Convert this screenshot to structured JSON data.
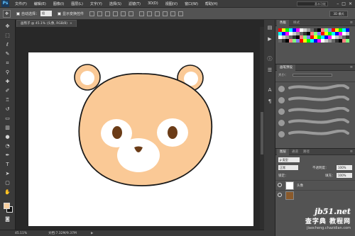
{
  "app": {
    "logo": "Ps"
  },
  "menubar": {
    "items": [
      "文件(F)",
      "编辑(E)",
      "图像(I)",
      "图层(L)",
      "文字(Y)",
      "选择(S)",
      "滤镜(T)",
      "3D(D)",
      "视图(V)",
      "窗口(W)",
      "帮助(H)"
    ],
    "workspace": "基本功能",
    "window_controls": [
      "–",
      "□",
      "✕"
    ]
  },
  "options": {
    "tool_icon": "move-tool-icon",
    "auto_select_label": "自动选择：",
    "auto_select_value": "组",
    "show_transform_label": "显示变换控件",
    "right_button": "3D 模式"
  },
  "document": {
    "tab_title": "画熊子 @ 45.1% (头像, RGB/8)",
    "close": "×",
    "fill": "#ffffff"
  },
  "status": {
    "zoom": "45.11%",
    "doc_size": "文档:7.32M/9.37M",
    "arrow": "▶"
  },
  "swatches": {
    "tabs": [
      "色板",
      "样式"
    ],
    "colors": [
      "#ff0000",
      "#ffff00",
      "#00ff00",
      "#00ffff",
      "#0000ff",
      "#ff00ff",
      "#ffffff",
      "#cccccc",
      "#999999",
      "#666666",
      "#333333",
      "#000000",
      "#ff8080",
      "#80ff80",
      "#8080ff"
    ]
  },
  "brush_panel": {
    "tabs": [
      "画笔预设"
    ],
    "size_label": "大小："
  },
  "layers_panel": {
    "tabs": [
      "图层",
      "通道",
      "路径"
    ],
    "kind_label": "ρ 类型",
    "blend_mode": "正常",
    "opacity_label": "不透明度：",
    "opacity_value": "100%",
    "lock_label": "锁定：",
    "fill_label": "填充：",
    "fill_value": "100%",
    "layer_name": "头像"
  },
  "bear": {
    "face_color": "#fac996",
    "inner_ear_color": "#ffffff",
    "eye_color": "#6b3c17",
    "muzzle_color": "#ffffff",
    "outline_color": "#1a1a1a"
  },
  "watermark": {
    "site": "jb51.net",
    "cn": "查字典 教程网",
    "url": "jiaocheng.chazidian.com"
  }
}
